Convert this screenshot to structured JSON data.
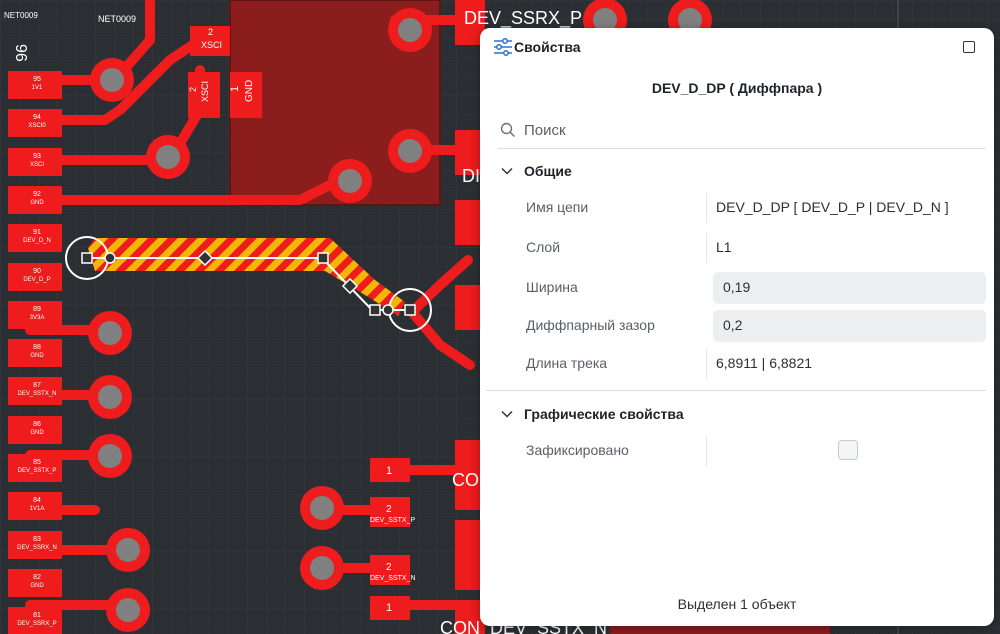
{
  "pcb": {
    "net_top_left": "NET0009",
    "net_top": "NET0009",
    "pin_big_label": "96",
    "pads": [
      {
        "num": "95",
        "net": "1V1"
      },
      {
        "num": "94",
        "net": "XSCI0"
      },
      {
        "num": "93",
        "net": "XSCI"
      },
      {
        "num": "92",
        "net": "GND"
      },
      {
        "num": "91",
        "net": "DEV_D_N"
      },
      {
        "num": "90",
        "net": "DEV_D_P"
      },
      {
        "num": "89",
        "net": "3V3A"
      },
      {
        "num": "88",
        "net": "GND"
      },
      {
        "num": "87",
        "net": "DEV_SSTX_N"
      },
      {
        "num": "86",
        "net": "GND"
      },
      {
        "num": "85",
        "net": "DEV_SSTX_P"
      },
      {
        "num": "84",
        "net": "1V1A"
      },
      {
        "num": "83",
        "net": "DEV_SSRX_N"
      },
      {
        "num": "82",
        "net": "GND"
      },
      {
        "num": "81",
        "net": "DEV_SSRX_P"
      }
    ],
    "comp_xsci_num": "2",
    "comp_xsci_net": "XSCI",
    "vert_xsci_num": "2",
    "vert_xsci_net": "XSCI",
    "vert_gnd_num": "1",
    "vert_gnd_net": "GND",
    "top_right_text": "DEV_SSRX_P",
    "mid_right_text": "DI",
    "con_text": "CON",
    "con_bottom_text": "CON_DEV_SSTX_N",
    "pad1_a": "1",
    "pad2_a_num": "2",
    "pad2_a_net": "DEV_SSTX_P",
    "pad2_b_num": "2",
    "pad2_b_net": "DEV_SSTX_N",
    "pad1_b": "1"
  },
  "panel": {
    "title": "Свойства",
    "object_title": "DEV_D_DP ( Диффпара )",
    "search_placeholder": "Поиск",
    "sections": {
      "general": {
        "label": "Общие",
        "rows": [
          {
            "label": "Имя цепи",
            "value": "DEV_D_DP [ DEV_D_P | DEV_D_N ]"
          },
          {
            "label": "Слой",
            "value": "L1"
          },
          {
            "label": "Ширина",
            "value": "0,19"
          },
          {
            "label": "Диффпарный зазор",
            "value": "0,2"
          },
          {
            "label": "Длина трека",
            "value": "6,8911 | 6,8821"
          }
        ]
      },
      "graphics": {
        "label": "Графические свойства",
        "rows": [
          {
            "label": "Зафиксировано",
            "checked": false
          }
        ]
      }
    },
    "status": "Выделен 1 объект"
  },
  "colors": {
    "board_bg": "#2b2f33",
    "copper": "#ee1c1c",
    "selection_yellow": "#f2b705",
    "pad_gray": "#808080"
  }
}
